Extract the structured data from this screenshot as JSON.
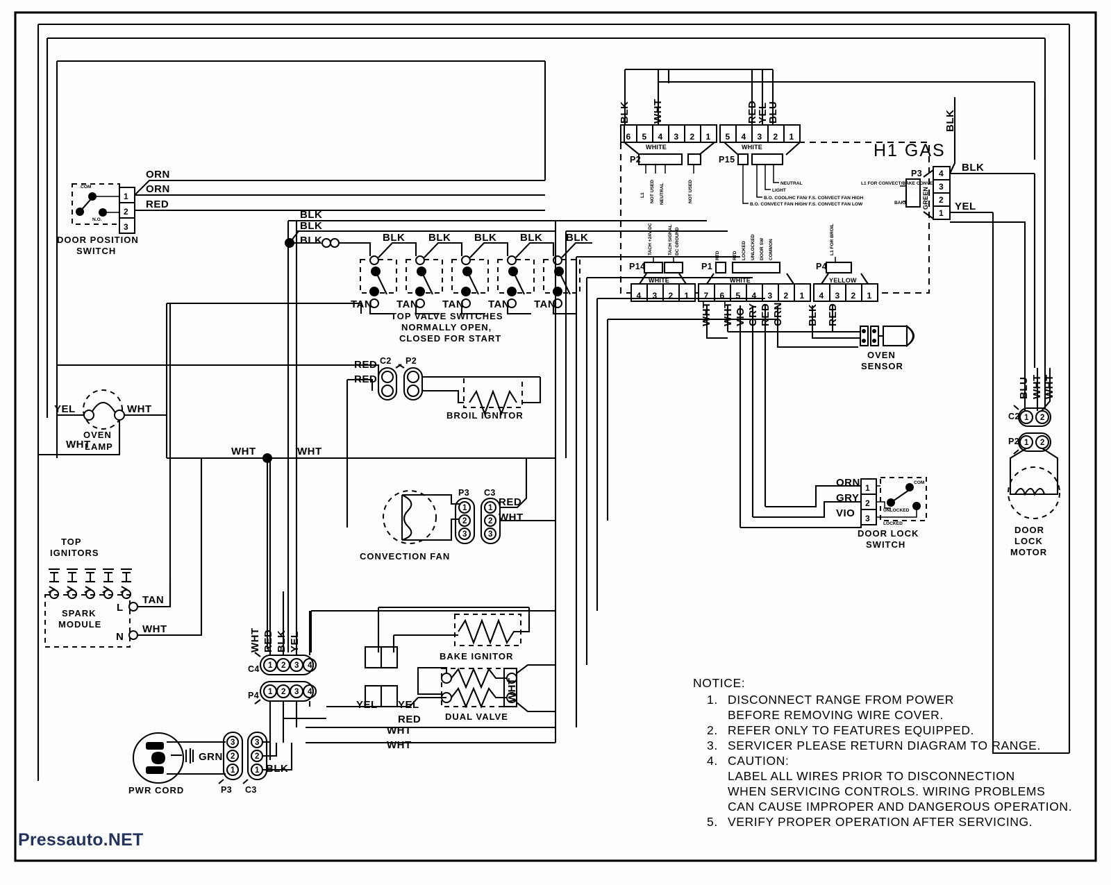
{
  "document": {
    "title": "Gas Range Wiring Diagram",
    "watermark": "Pressauto.NET",
    "board_title": "H1  GAS"
  },
  "components": {
    "door_position_switch": {
      "name": "DOOR POSITION\nSWITCH",
      "line1": "DOOR POSITION",
      "line2": "SWITCH",
      "terminals": [
        "1",
        "2",
        "3"
      ],
      "wires": [
        "ORN",
        "ORN",
        "RED"
      ],
      "marks": [
        "COM",
        "N.O."
      ]
    },
    "top_valve_switches": {
      "line1": "TOP VALVE SWITCHES",
      "line2": "NORMALLY OPEN,",
      "line3": "CLOSED FOR START",
      "top_wires": [
        "BLK",
        "BLK",
        "BLK",
        "BLK",
        "BLK"
      ],
      "bottom_wires": [
        "TAN",
        "TAN",
        "TAN",
        "TAN",
        "TAN"
      ],
      "feed_wires": [
        "BLK",
        "BLK",
        "BLK"
      ]
    },
    "oven_lamp": {
      "line1": "OVEN",
      "line2": "LAMP",
      "left_wire": "YEL",
      "right_wire": "WHT",
      "bottom_wire": "WHT"
    },
    "top_ignitors": {
      "line1": "TOP",
      "line2": "IGNITORS",
      "count": 5
    },
    "spark_module": {
      "line1": "SPARK",
      "line2": "MODULE",
      "terminals": [
        "L",
        "N"
      ],
      "wires": [
        "TAN",
        "WHT"
      ]
    },
    "broil_ignitor": {
      "label": "BROIL  IGNITOR",
      "connectors": [
        "C2",
        "P2"
      ],
      "wires": [
        "RED",
        "RED"
      ]
    },
    "convection_fan": {
      "label": "CONVECTION FAN",
      "connectors": [
        "P3",
        "C3"
      ],
      "pins": [
        "1",
        "2",
        "3"
      ],
      "wires": [
        "RED",
        "WHT"
      ]
    },
    "bake_ignitor": {
      "label": "BAKE  IGNITOR"
    },
    "dual_valve": {
      "label": "DUAL VALVE",
      "wires": [
        "YEL",
        "YEL",
        "RED",
        "WHT",
        "WHT",
        "WHT"
      ]
    },
    "power_cord": {
      "label": "PWR CORD",
      "ground_wire": "GRN",
      "connectors": [
        "P3",
        "C3"
      ],
      "pins": [
        "3",
        "2",
        "1"
      ],
      "wire": "BLK"
    },
    "c4_connector": {
      "label": "C4",
      "pins": [
        "1",
        "2",
        "3",
        "4"
      ],
      "wires": [
        "WHT",
        "RED",
        "BLK",
        "YEL"
      ]
    },
    "p4_connector": {
      "label": "P4",
      "pins": [
        "1",
        "2",
        "3",
        "4"
      ]
    },
    "oven_sensor": {
      "line1": "OVEN",
      "line2": "SENSOR"
    },
    "door_lock_switch": {
      "line1": "DOOR LOCK",
      "line2": "SWITCH",
      "terminals": [
        "1",
        "2",
        "3"
      ],
      "wires": [
        "ORN",
        "GRY",
        "VIO"
      ],
      "marks": [
        "COM",
        "UNLOCKED",
        "LOCKED"
      ]
    },
    "door_lock_motor": {
      "line1": "DOOR",
      "line2": "LOCK",
      "line3": "MOTOR",
      "connectors": [
        "C2",
        "P2"
      ],
      "pins": [
        "1",
        "2"
      ],
      "wires": [
        "BLU",
        "WHT",
        "WHT"
      ]
    }
  },
  "control_board": {
    "title": "H1  GAS",
    "connectors": [
      {
        "id": "P2",
        "color_label": "WHITE",
        "header_pins": [
          "6",
          "5",
          "4",
          "3",
          "2",
          "1"
        ],
        "header_wires": [
          "BLK",
          "WHT"
        ],
        "pin_labels": [
          "L1",
          "NOT USED",
          "NEUTRAL",
          "NOT USED"
        ]
      },
      {
        "id": "P15",
        "color_label": "WHITE",
        "header_pins": [
          "5",
          "4",
          "3",
          "2",
          "1"
        ],
        "header_wires": [
          "RED",
          "YEL",
          "BLU"
        ],
        "pin_labels": [
          "B.O. CONVECT FAN HIGH/ F.S. CONVECT FAN LOW",
          "B.O. COOL/HC FAN/ F.S. CONVECT FAN HIGH",
          "LIGHT",
          "NEUTRAL"
        ]
      },
      {
        "id": "P14",
        "color_label": "WHITE",
        "header_pins": [
          "4",
          "3",
          "2",
          "1"
        ],
        "pin_labels": [
          "TACH +24V DC",
          "TACH SIGNAL",
          "DC GROUND"
        ]
      },
      {
        "id": "P1",
        "color_label": "WHITE",
        "header_pins": [
          "7",
          "6",
          "5",
          "4",
          "3",
          "2",
          "1"
        ],
        "header_wires": [
          "WHT",
          "WHT",
          "VIO",
          "GRY",
          "RED",
          "ORN"
        ],
        "pin_labels": [
          "RTD",
          "RTD",
          "LOCKED",
          "UNLOCKED",
          "DOOR SW",
          "COMMON"
        ]
      },
      {
        "id": "P4",
        "color_label": "YELLOW",
        "header_pins": [
          "4",
          "3",
          "2",
          "1"
        ],
        "header_wires": [
          "BLK",
          "RED"
        ],
        "pin_labels": [
          "L1 FOR BROIL"
        ]
      },
      {
        "id": "P3",
        "color_label": "GREEN",
        "header_pins": [
          "4",
          "3",
          "2",
          "1"
        ],
        "header_wires": [
          "BLK",
          "YEL"
        ],
        "pin_labels": [
          "L1 FOR CONVECT/BAKE CONVECT",
          "BAKE"
        ]
      }
    ]
  },
  "notice": {
    "heading": "NOTICE:",
    "items": [
      {
        "num": "1.",
        "lines": [
          "DISCONNECT RANGE FROM POWER",
          "BEFORE REMOVING WIRE COVER."
        ]
      },
      {
        "num": "2.",
        "lines": [
          "REFER ONLY TO FEATURES EQUIPPED."
        ]
      },
      {
        "num": "3.",
        "lines": [
          "SERVICER PLEASE RETURN DIAGRAM TO RANGE."
        ]
      },
      {
        "num": "4.",
        "lines": [
          "CAUTION:",
          "LABEL ALL WIRES PRIOR TO DISCONNECTION",
          "WHEN SERVICING CONTROLS. WIRING PROBLEMS",
          "CAN CAUSE IMPROPER AND DANGEROUS OPERATION."
        ]
      },
      {
        "num": "5.",
        "lines": [
          "VERIFY PROPER OPERATION AFTER SERVICING."
        ]
      }
    ]
  },
  "wire_labels": {
    "orn": "ORN",
    "red": "RED",
    "blk": "BLK",
    "tan": "TAN",
    "wht": "WHT",
    "yel": "YEL",
    "blu": "BLU",
    "gry": "GRY",
    "vio": "VIO",
    "grn": "GRN"
  }
}
